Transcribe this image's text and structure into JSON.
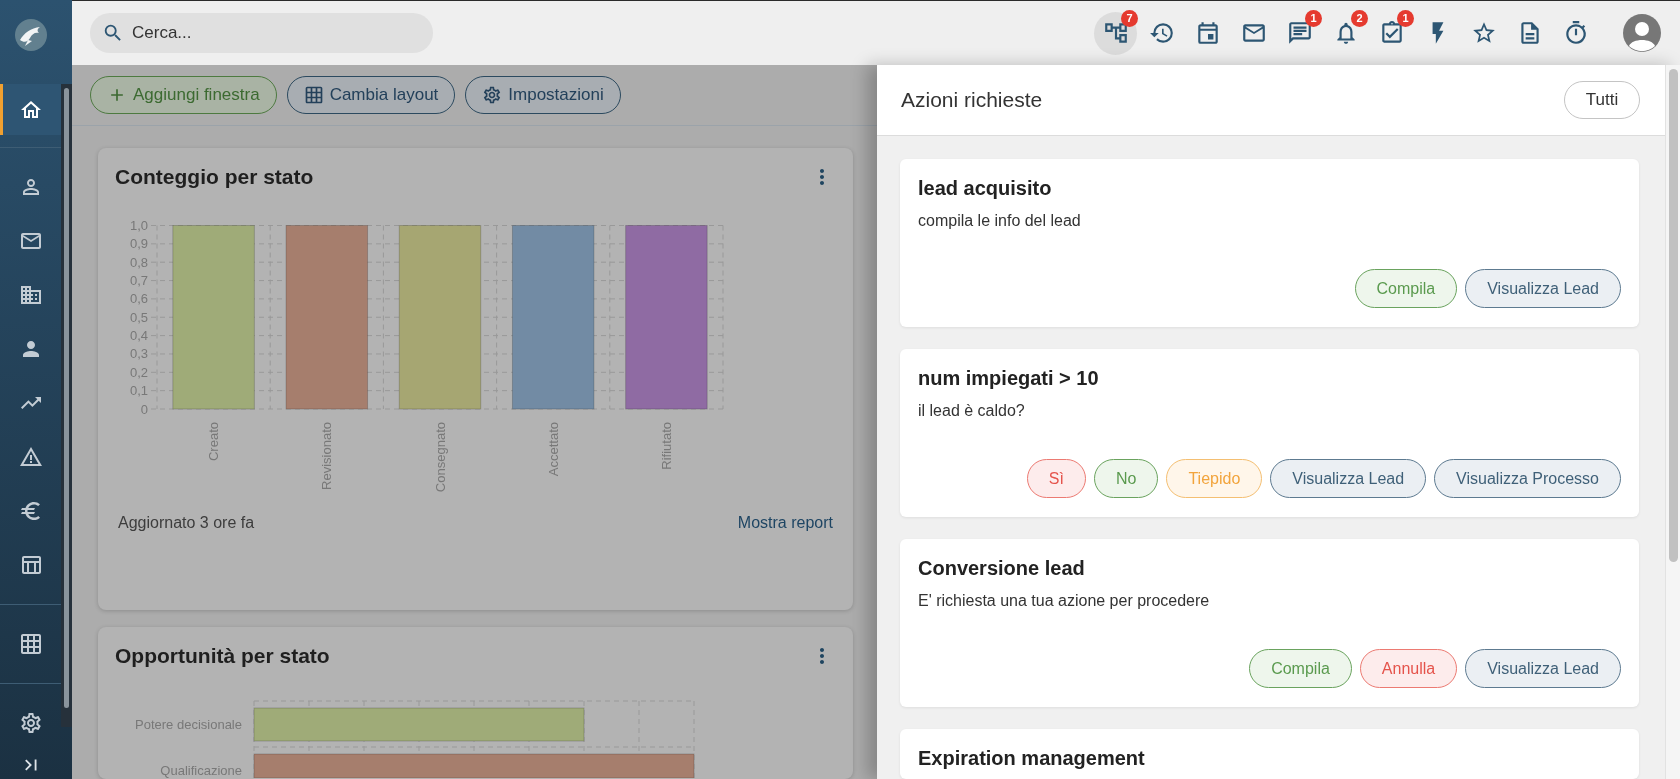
{
  "sidebar": {
    "sections": [
      {
        "items": [
          {
            "selected": true
          }
        ]
      },
      {
        "items": [
          {
            "selected": false
          },
          {
            "selected": false
          },
          {
            "selected": false
          },
          {
            "selected": false
          },
          {
            "selected": false
          },
          {
            "selected": false
          },
          {
            "selected": false
          },
          {
            "selected": false
          }
        ]
      },
      {
        "items": [
          {
            "selected": false
          }
        ]
      },
      {
        "items": [
          {
            "selected": false
          }
        ]
      }
    ]
  },
  "topbar": {
    "search": {
      "placeholder": "Cerca..."
    },
    "actions": [
      {
        "selected": true,
        "badge": "7"
      },
      {
        "selected": false
      },
      {
        "selected": false
      },
      {
        "selected": false
      },
      {
        "selected": false,
        "badge": "1"
      },
      {
        "selected": false,
        "badge": "2"
      },
      {
        "selected": false,
        "badge": "1"
      },
      {
        "selected": false
      },
      {
        "selected": false
      },
      {
        "selected": false
      },
      {
        "selected": false
      }
    ]
  },
  "toolbar": {
    "buttons": [
      {
        "label": "Aggiungi finestra",
        "kind": "add"
      },
      {
        "label": "Cambia layout",
        "kind": "layout"
      },
      {
        "label": "Impostazioni",
        "kind": "settings"
      }
    ]
  },
  "widgets": [
    {
      "kind": "bar_chart",
      "title": "Conteggio per stato",
      "chart_data": {
        "type": "bar",
        "categories": [
          "Creato",
          "Revisionato",
          "Consegnato",
          "Accettato",
          "Rifiutato"
        ],
        "values": [
          1,
          1,
          1,
          1,
          1
        ],
        "colors": [
          "#9fab78",
          "#a67e6d",
          "#a6a672",
          "#728ba4",
          "#8f6ba3"
        ],
        "ylim": [
          0,
          1
        ],
        "yticks": [
          {
            "value": 0,
            "label": "0"
          },
          {
            "value": 0.1,
            "label": "0,1"
          },
          {
            "value": 0.2,
            "label": "0,2"
          },
          {
            "value": 0.3,
            "label": "0,3"
          },
          {
            "value": 0.4,
            "label": "0,4"
          },
          {
            "value": 0.5,
            "label": "0,5"
          },
          {
            "value": 0.6,
            "label": "0,6"
          },
          {
            "value": 0.7,
            "label": "0,7"
          },
          {
            "value": 0.8,
            "label": "0,8"
          },
          {
            "value": 0.9,
            "label": "0,9"
          },
          {
            "value": 1,
            "label": "1,0"
          }
        ],
        "grid": true
      },
      "updated": "Aggiornato 3 ore fa",
      "link": "Mostra report"
    },
    {
      "kind": "horizontal_bars",
      "title": "Opportunità per stato",
      "rows": [
        {
          "label": "Potere decisionale",
          "color": "#9fab78"
        },
        {
          "label": "Qualificazione",
          "color": "#a67e6d"
        }
      ]
    }
  ],
  "panel": {
    "title": "Azioni richieste",
    "filter_button": "Tutti",
    "cards": [
      {
        "title": "lead acquisito",
        "description": "compila le info del lead",
        "buttons": [
          {
            "label": "Compila",
            "kind": "positive"
          },
          {
            "label": "Visualizza Lead",
            "kind": "neutral"
          }
        ]
      },
      {
        "title": "num impiegati > 10",
        "description": "il lead è caldo?",
        "buttons": [
          {
            "label": "Sì",
            "kind": "negative"
          },
          {
            "label": "No",
            "kind": "positive"
          },
          {
            "label": "Tiepido",
            "kind": "warning"
          },
          {
            "label": "Visualizza Lead",
            "kind": "neutral"
          },
          {
            "label": "Visualizza Processo",
            "kind": "neutral"
          }
        ]
      },
      {
        "title": "Conversione lead",
        "description": "E' richiesta una tua azione per procedere",
        "buttons": [
          {
            "label": "Compila",
            "kind": "positive"
          },
          {
            "label": "Annulla",
            "kind": "negative"
          },
          {
            "label": "Visualizza Lead",
            "kind": "neutral"
          }
        ]
      },
      {
        "title": "Expiration management"
      }
    ]
  }
}
